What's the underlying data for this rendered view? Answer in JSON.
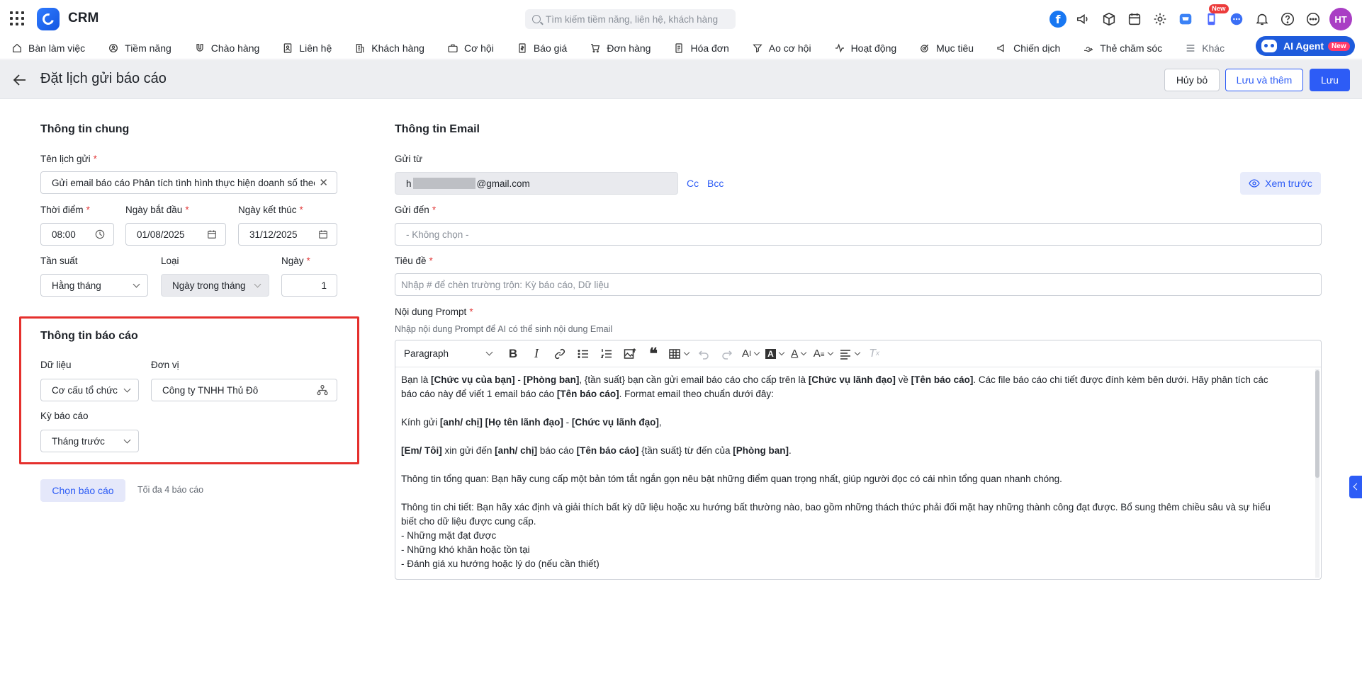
{
  "app": {
    "brand": "CRM"
  },
  "search": {
    "placeholder": "Tìm kiếm tiềm năng, liên hệ, khách hàng"
  },
  "topbar": {
    "new_badge": "New",
    "avatar_initials": "HT",
    "facebook_letter": "f"
  },
  "nav": {
    "items": [
      {
        "label": "Bàn làm việc",
        "icon": "home-icon"
      },
      {
        "label": "Tiềm năng",
        "icon": "target-user-icon"
      },
      {
        "label": "Chào hàng",
        "icon": "magnet-icon"
      },
      {
        "label": "Liên hệ",
        "icon": "contact-icon"
      },
      {
        "label": "Khách hàng",
        "icon": "building-icon"
      },
      {
        "label": "Cơ hội",
        "icon": "briefcase-icon"
      },
      {
        "label": "Báo giá",
        "icon": "quote-icon"
      },
      {
        "label": "Đơn hàng",
        "icon": "cart-icon"
      },
      {
        "label": "Hóa đơn",
        "icon": "invoice-icon"
      },
      {
        "label": "Ao cơ hội",
        "icon": "funnel-icon"
      },
      {
        "label": "Hoạt động",
        "icon": "activity-icon"
      },
      {
        "label": "Mục tiêu",
        "icon": "goal-icon"
      },
      {
        "label": "Chiến dịch",
        "icon": "megaphone-icon"
      },
      {
        "label": "Thẻ chăm sóc",
        "icon": "care-card-icon"
      },
      {
        "label": "Khác",
        "icon": "menu-icon"
      }
    ],
    "ai_agent": "AI Agent",
    "ai_new": "New"
  },
  "header": {
    "title": "Đặt lịch gửi báo cáo",
    "cancel": "Hủy bỏ",
    "save_add": "Lưu và thêm",
    "save": "Lưu"
  },
  "general": {
    "title": "Thông tin chung",
    "schedule_name_label": "Tên lịch gửi",
    "schedule_name_value": "Gửi email báo cáo Phân tích tình hình thực hiện doanh số theo",
    "time_label": "Thời điểm",
    "time_value": "08:00",
    "start_label": "Ngày bắt đầu",
    "start_value": "01/08/2025",
    "end_label": "Ngày kết thúc",
    "end_value": "31/12/2025",
    "freq_label": "Tần suất",
    "freq_value": "Hằng tháng",
    "type_label": "Loại",
    "type_value": "Ngày trong tháng",
    "day_label": "Ngày",
    "day_value": "1",
    "required_mark": "*"
  },
  "report": {
    "title": "Thông tin báo cáo",
    "data_label": "Dữ liệu",
    "data_value": "Cơ cấu tổ chức",
    "unit_label": "Đơn vị",
    "unit_value": "Công ty TNHH Thủ Đô",
    "period_label": "Kỳ báo cáo",
    "period_value": "Tháng trước",
    "choose_button": "Chọn báo cáo",
    "choose_hint": "Tối đa 4 báo cáo"
  },
  "email": {
    "title": "Thông tin Email",
    "from_label": "Gửi từ",
    "from_prefix": "h",
    "from_suffix": "@gmail.com",
    "cc": "Cc",
    "bcc": "Bcc",
    "preview": "Xem trước",
    "to_label": "Gửi đến",
    "to_placeholder": "- Không chọn -",
    "subject_label": "Tiêu đề",
    "subject_placeholder": "Nhập # để chèn trường trộn: Kỳ báo cáo, Dữ liệu",
    "prompt_label": "Nội dung Prompt",
    "prompt_hint": "Nhập nội dung Prompt để AI có thể sinh nội dung Email",
    "paragraph_select": "Paragraph"
  },
  "prompt_text": {
    "p1_a": "Bạn là ",
    "p1_b": "[Chức vụ của bạn]",
    "p1_c": " - ",
    "p1_d": "[Phòng ban]",
    "p1_e": ", {tần suất} bạn cần gửi email báo cáo cho cấp trên là ",
    "p1_f": "[Chức vụ lãnh đạo]",
    "p1_g": " về ",
    "p1_h": "[Tên báo cáo]",
    "p1_i": ". Các file báo cáo chi tiết được đính kèm bên dưới. Hãy phân tích các báo cáo này để viết 1 email báo cáo ",
    "p1_j": "[Tên báo cáo]",
    "p1_k": ". Format email theo chuẩn dưới đây:",
    "p2_a": "Kính gửi ",
    "p2_b": "[anh/ chị] [Họ tên lãnh đạo]",
    "p2_c": " - ",
    "p2_d": "[Chức vụ lãnh đạo]",
    "p2_e": ",",
    "p3_a": "[Em/ Tôi]",
    "p3_b": " xin gửi đến ",
    "p3_c": "[anh/ chị]",
    "p3_d": " báo cáo ",
    "p3_e": "[Tên báo cáo]",
    "p3_f": " {tần suất} từ đến của ",
    "p3_g": "[Phòng ban]",
    "p3_h": ".",
    "p4": "Thông tin tổng quan: Bạn hãy cung cấp một bản tóm tắt ngắn gọn nêu bật những điểm quan trọng nhất, giúp người đọc có cái nhìn tổng quan nhanh chóng.",
    "p5": "Thông tin chi tiết: Bạn hãy xác định và giải thích bất kỳ dữ liệu hoặc xu hướng bất thường nào, bao gồm những thách thức phải đối mặt hay những thành công đạt được. Bổ sung thêm chiều sâu và sự hiểu biết cho dữ liệu được cung cấp.",
    "li1": "- Những mặt đạt được",
    "li2": "- Những khó khăn hoặc tồn tại",
    "li3": "- Đánh giá xu hướng hoặc lý do (nếu cần thiết)"
  },
  "colors": {
    "accent": "#2d5cf6",
    "highlight_box": "#e5302d",
    "header_band": "#edeef1"
  }
}
